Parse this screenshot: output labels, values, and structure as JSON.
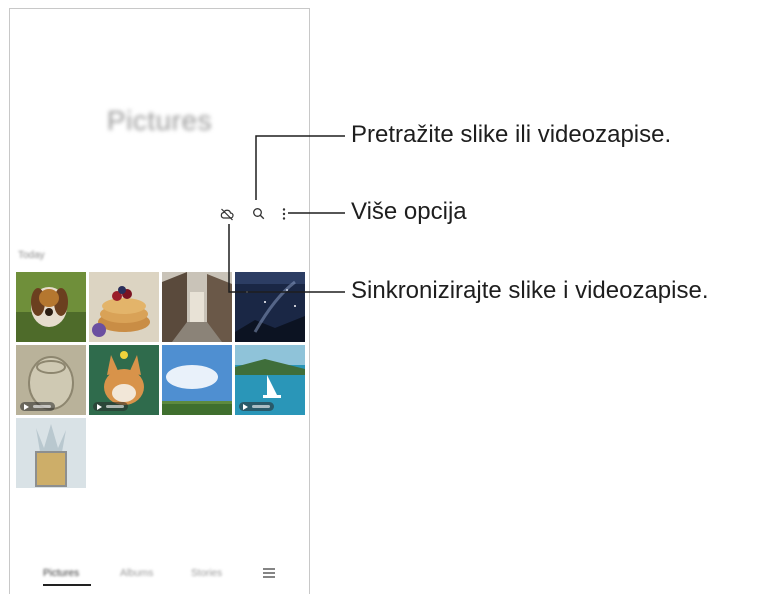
{
  "app": {
    "title": "Pictures",
    "section_title": "Today"
  },
  "toolbar": {
    "icons": [
      "cloud-sync-off-icon",
      "search-icon",
      "more-options-icon"
    ]
  },
  "gallery": {
    "items": [
      {
        "subject": "beagle dog in grass",
        "type": "photo"
      },
      {
        "subject": "pancakes with berries",
        "type": "photo"
      },
      {
        "subject": "village street",
        "type": "photo"
      },
      {
        "subject": "starry night sky",
        "type": "photo"
      },
      {
        "subject": "glass vase",
        "type": "video"
      },
      {
        "subject": "corgi with flower",
        "type": "video"
      },
      {
        "subject": "blue sky field",
        "type": "photo"
      },
      {
        "subject": "sailboat in bay",
        "type": "video"
      },
      {
        "subject": "water splash in glass",
        "type": "photo"
      }
    ]
  },
  "bottom_nav": {
    "tabs": [
      {
        "label": "Pictures",
        "active": true
      },
      {
        "label": "Albums",
        "active": false
      },
      {
        "label": "Stories",
        "active": false
      }
    ],
    "menu_icon": "menu-icon"
  },
  "callouts": {
    "search": "Pretražite slike ili videozapise.",
    "more": "Više opcija",
    "sync": "Sinkronizirajte slike i videozapise."
  },
  "colors": {
    "leader_line": "#1e1e1e",
    "frame_border": "#c8c8c8"
  }
}
